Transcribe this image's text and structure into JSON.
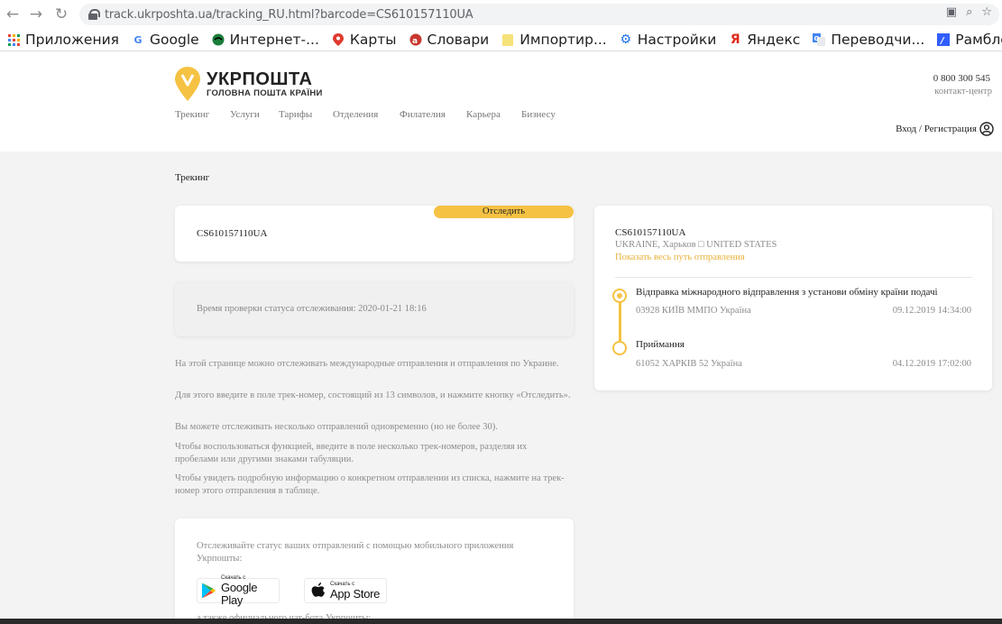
{
  "browser": {
    "url": "track.ukrposhta.ua/tracking_RU.html?barcode=CS610157110UA",
    "bookmarks": [
      {
        "label": "Приложения",
        "icon": "apps-grid-icon"
      },
      {
        "label": "Google",
        "icon": "google-icon"
      },
      {
        "label": "Интернет-...",
        "icon": "globe-icon"
      },
      {
        "label": "Карты",
        "icon": "maps-pin-icon"
      },
      {
        "label": "Словари",
        "icon": "dictionary-icon"
      },
      {
        "label": "Импортир...",
        "icon": "folder-icon"
      },
      {
        "label": "Настройки",
        "icon": "gear-icon"
      },
      {
        "label": "Яндекс",
        "icon": "yandex-icon"
      },
      {
        "label": "Переводчи...",
        "icon": "translate-icon"
      },
      {
        "label": "Рамблер -...",
        "icon": "rambler-icon"
      }
    ]
  },
  "header": {
    "logo_name": "УКРПОШТА",
    "logo_subtitle": "ГОЛОВНА ПОШТА КРАЇНИ",
    "nav": [
      "Трекинг",
      "Услуги",
      "Тарифы",
      "Отделения",
      "Филателия",
      "Карьера",
      "Бизнесу"
    ],
    "phone": "0 800 300 545",
    "phone_label": "контакт-центр",
    "login": "Вход / Регистрация"
  },
  "main": {
    "breadcrumb": "Трекинг",
    "search": {
      "value": "CS610157110UA",
      "button": "Отследить"
    },
    "status_time": "Время проверки статуса отслеживания: 2020-01-21 18:16",
    "info": [
      "На этой странице можно отслеживать международные отправления и отправления по Украине.",
      "Для этого введите в поле трек-номер, состоящий из 13 символов, и нажмите кнопку «Отследить».",
      "Вы можете отслеживать несколько отправлений одновременно (но не более 30).",
      "Чтобы воспользоваться функцией, введите в поле несколько трек-номеров, разделяя их пробелами или другими знаками табуляции.",
      "Чтобы увидеть подробную информацию о конкретном отправлении из списка, нажмите на трек-номер этого отправления в таблице."
    ],
    "app": {
      "text": "Отслеживайте статус ваших отправлений с помощью мобильного приложения Укрпошты:",
      "google_small": "Скачать с",
      "google_big": "Google Play",
      "apple_small": "Скачать с",
      "apple_big": "App Store",
      "more": "а также официального чат-бота Укрпошты:"
    }
  },
  "result": {
    "barcode": "CS610157110UA",
    "route": "UKRAINE, Харьков □ UNITED STATES",
    "show_path": "Показать весь путь отправления",
    "events": [
      {
        "title": "Відправка міжнародного відправлення з установи обміну країни подачі",
        "place": "03928 КИЇВ ММПО Україна",
        "date": "09.12.2019 14:34:00"
      },
      {
        "title": "Приймання",
        "place": "61052 ХАРКІВ 52 Україна",
        "date": "04.12.2019 17:02:00"
      }
    ]
  },
  "colors": {
    "accent": "#f5c243",
    "link": "#e8b23a",
    "background": "#f3f3f3"
  }
}
